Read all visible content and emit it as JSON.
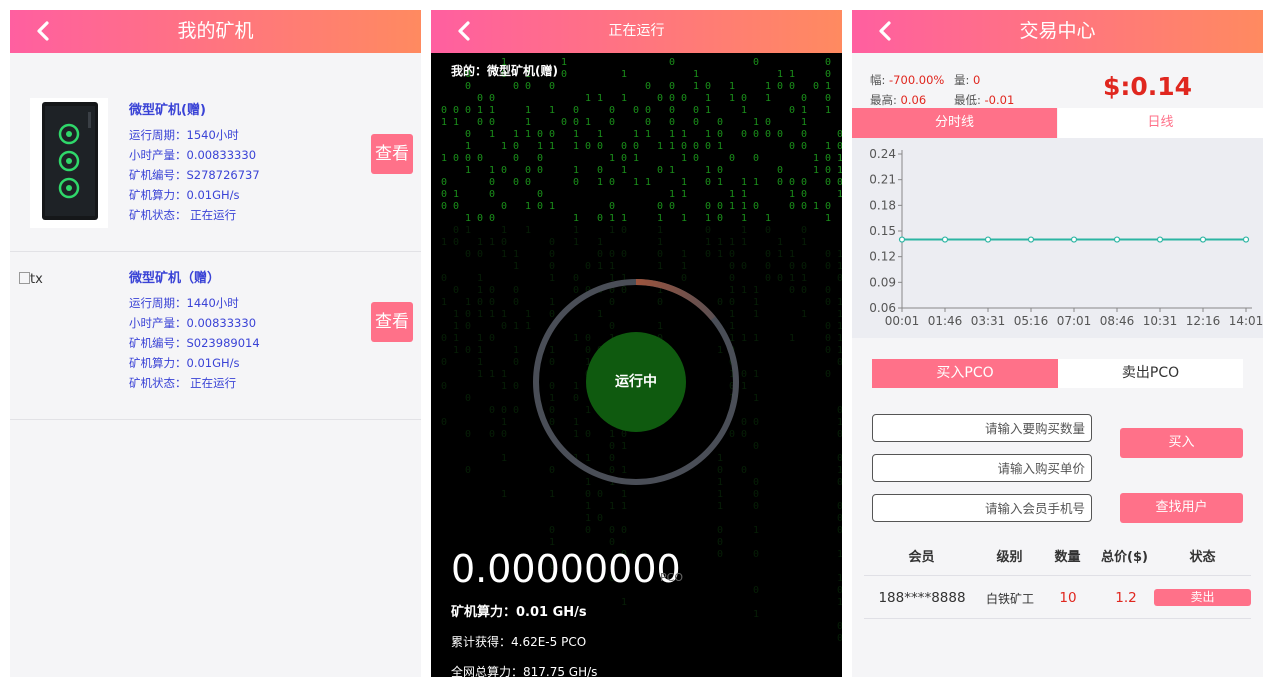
{
  "colors": {
    "header_gradient_start": "#ff5fa0",
    "header_gradient_end": "#ff8a60",
    "accent_pink": "#ff7189",
    "miner_text_blue": "#3a43d6",
    "price_red": "#e0271f",
    "matrix_green": "#1fa81f",
    "chart_line_teal": "#2bb5a3"
  },
  "my_miners": {
    "back_icon": "chevron-left-icon",
    "title": "我的矿机",
    "view_label": "查看",
    "miners": [
      {
        "name": "微型矿机(赠)",
        "cycle": "运行周期：1540小时",
        "output": "小时产量：0.00833330",
        "serial": "矿机编号：S278726737",
        "power": "矿机算力：0.01GH/s",
        "status": "矿机状态：  正在运行",
        "image_alt": ""
      },
      {
        "name": "微型矿机（赠）",
        "cycle": "运行周期：1440小时",
        "output": "小时产量：0.00833330",
        "serial": "矿机编号：S023989014",
        "power": "矿机算力：0.01GH/s",
        "status": "矿机状态：  正在运行",
        "image_alt": "tx"
      }
    ]
  },
  "running": {
    "back_icon": "chevron-left-icon",
    "title": "正在运行",
    "mine_label": "我的：微型矿机(赠)",
    "status_label": "运行中",
    "progress_fraction": 0.14,
    "amount": "0.00000000",
    "amount_unit": "PCO",
    "miner_power": "矿机算力：0.01 GH/s",
    "total_earned": "累计获得：4.62E-5 PCO",
    "network_power": "全网总算力：817.75 GH/s"
  },
  "trading": {
    "back_icon": "chevron-left-icon",
    "title": "交易中心",
    "change_label": "幅: ",
    "change_value": "-700.00%",
    "volume_label": "量: ",
    "volume_value": "0",
    "high_label": "最高: ",
    "high_value": "0.06",
    "low_label": "最低: ",
    "low_value": "-0.01",
    "price": "$:0.14",
    "period_tabs": [
      "分时线",
      "日线"
    ],
    "trade_tabs": [
      "买入PCO",
      "卖出PCO"
    ],
    "inputs": {
      "quantity_placeholder": "请输入要购买数量",
      "price_placeholder": "请输入购买单价",
      "phone_placeholder": "请输入会员手机号"
    },
    "buy_label": "买入",
    "find_user_label": "查找用户",
    "table": {
      "headers": [
        "会员",
        "级别",
        "数量",
        "总价($)",
        "状态"
      ],
      "rows": [
        {
          "member": "188****8888",
          "level": "白铁矿工",
          "qty": "10",
          "total": "1.2",
          "action": "卖出"
        }
      ]
    }
  },
  "chart_data": {
    "type": "line",
    "title": "",
    "xlabel": "",
    "ylabel": "",
    "x": [
      "00:01",
      "01:46",
      "03:31",
      "05:16",
      "07:01",
      "08:46",
      "10:31",
      "12:16",
      "14:01"
    ],
    "yticks": [
      "0.24",
      "0.21",
      "0.18",
      "0.15",
      "0.12",
      "0.09",
      "0.06"
    ],
    "ylim": [
      0.06,
      0.24
    ],
    "series": [
      {
        "values": [
          0.14,
          0.14,
          0.14,
          0.14,
          0.14,
          0.14,
          0.14,
          0.14,
          0.14
        ]
      }
    ],
    "grid": false
  }
}
